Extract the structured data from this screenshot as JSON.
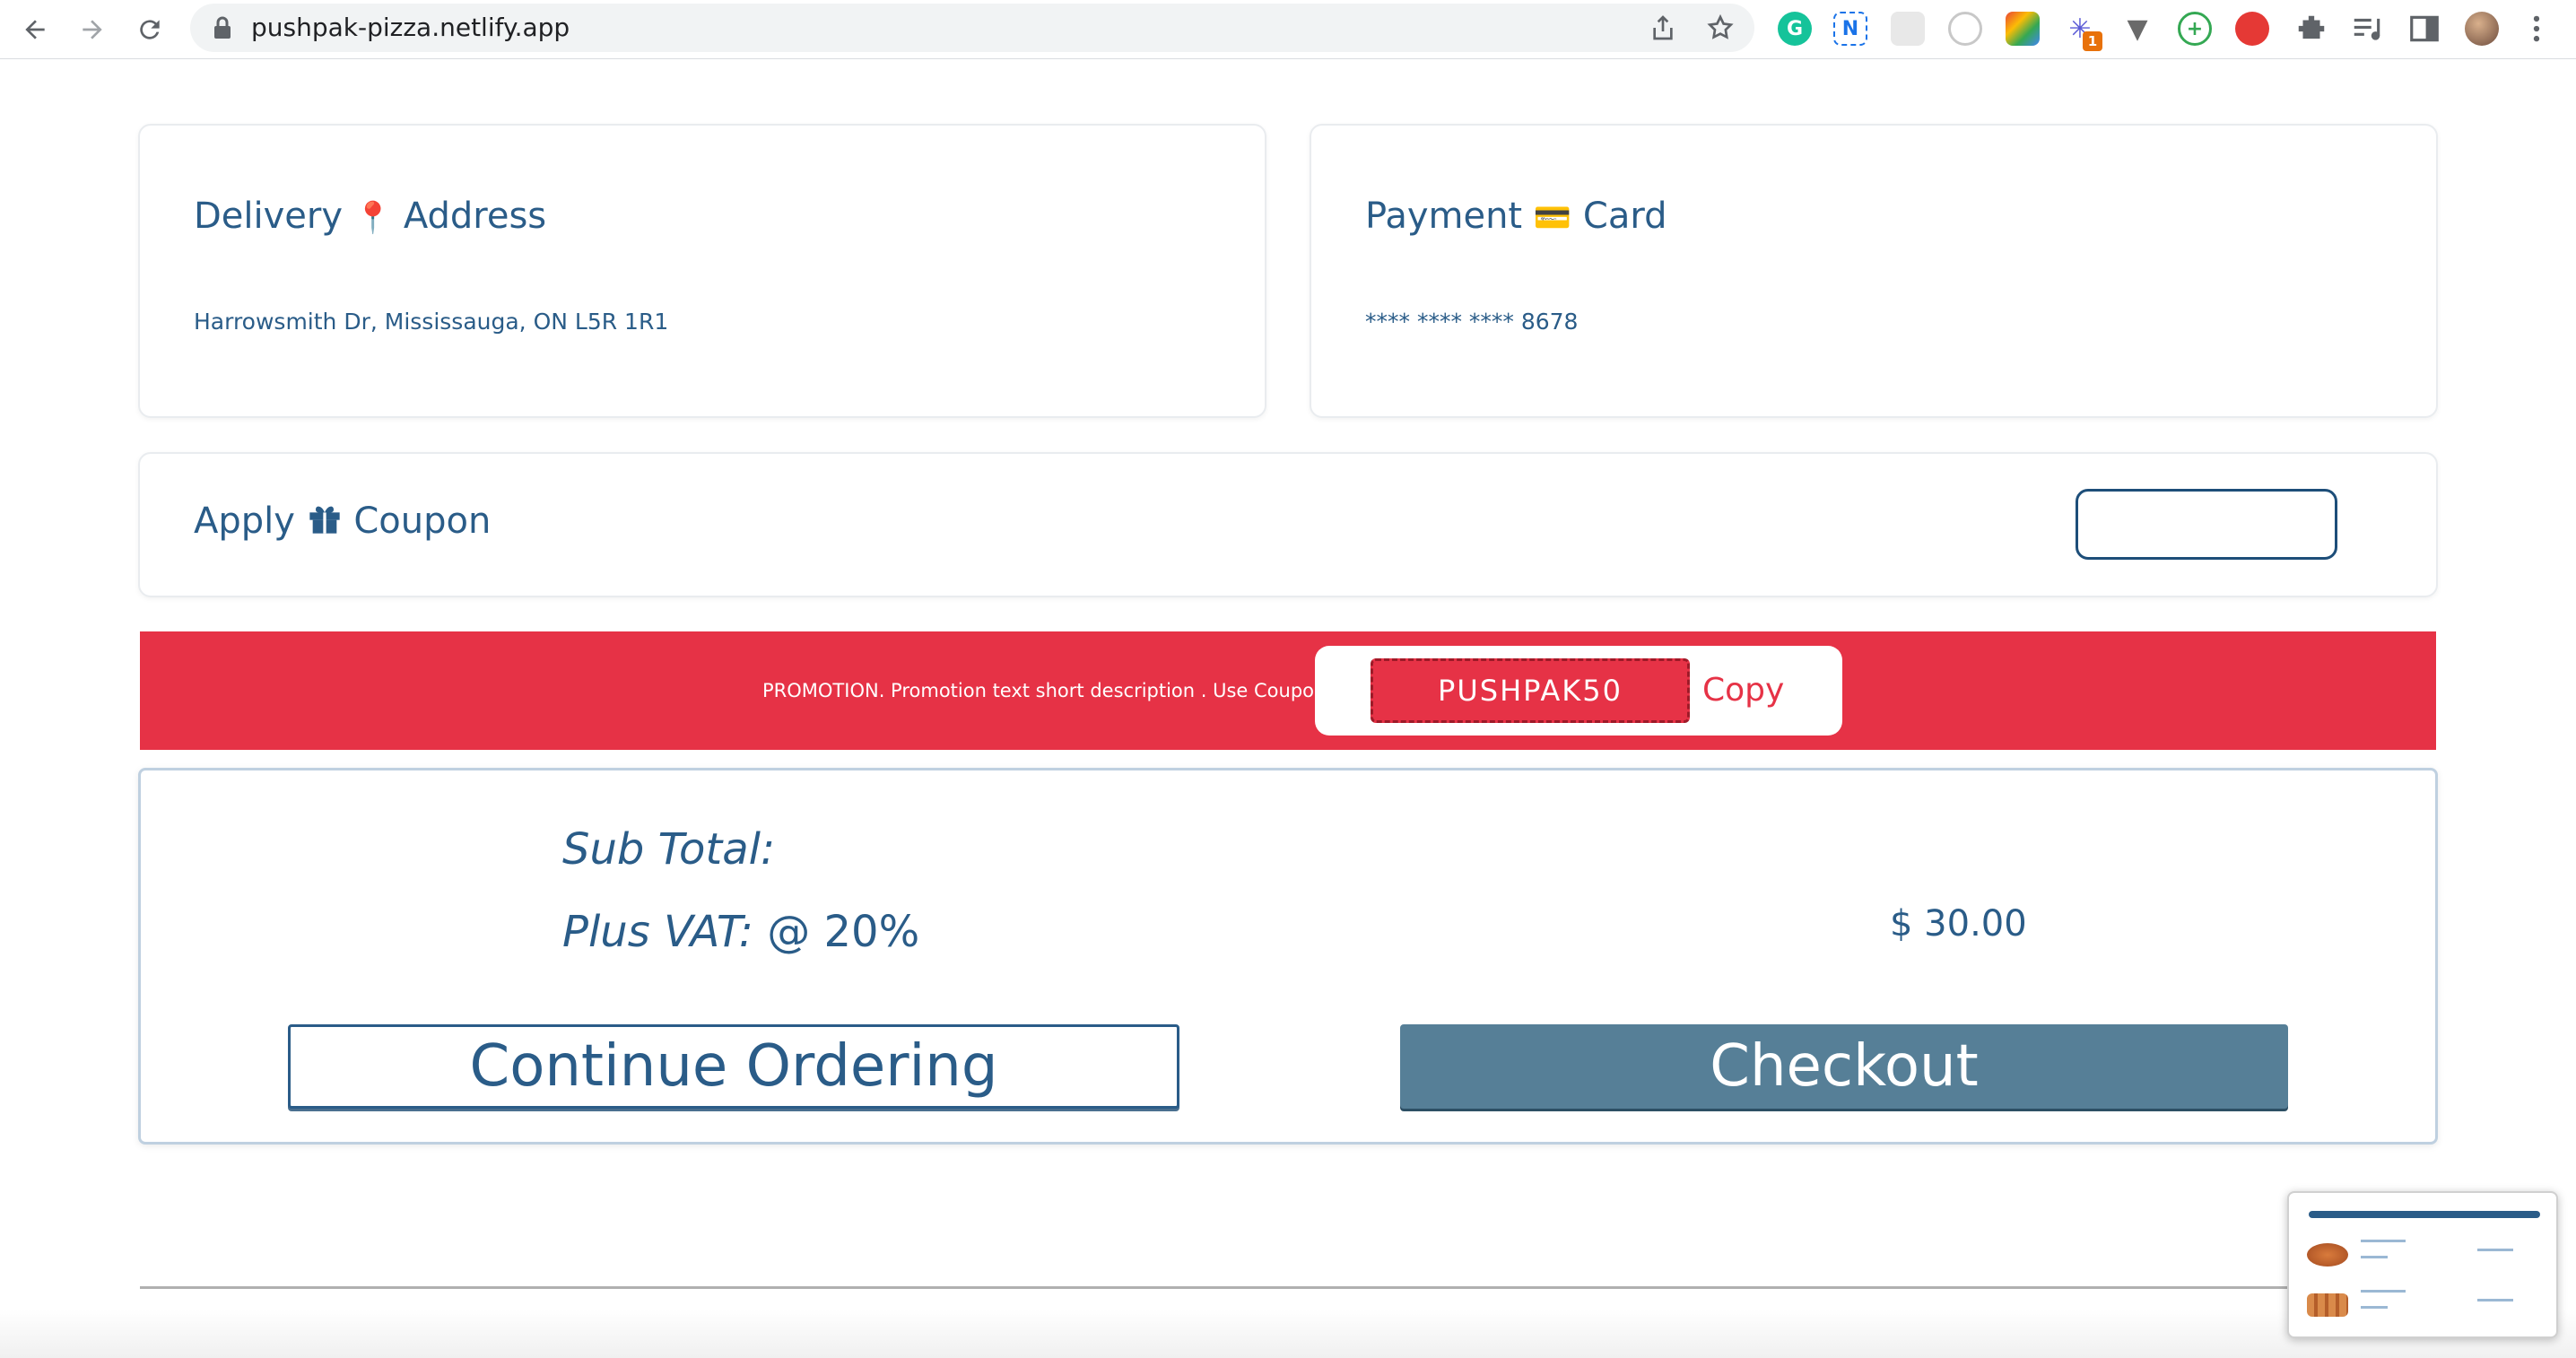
{
  "browser": {
    "url": "pushpak-pizza.netlify.app",
    "extension_badge": "1"
  },
  "delivery": {
    "title_pre": "Delivery",
    "title_icon": "📍",
    "title_post": "Address",
    "address": "Harrowsmith Dr, Mississauga, ON L5R 1R1"
  },
  "payment": {
    "title_pre": "Payment",
    "title_icon": "💳",
    "title_post": "Card",
    "card": "**** **** **** 8678"
  },
  "coupon": {
    "title_pre": "Apply",
    "title_post": "Coupon",
    "input_value": ""
  },
  "promo": {
    "text": "PROMOTION. Promotion text short description . Use Coupon",
    "code": "PUSHPAK50",
    "copy_label": "Copy"
  },
  "totals": {
    "subtotal_label": "Sub Total:",
    "vat_label": "Plus VAT:",
    "vat_rate": "@ 20%",
    "amount": "$ 30.00"
  },
  "actions": {
    "continue_label": "Continue Ordering",
    "checkout_label": "Checkout"
  },
  "colors": {
    "brand_blue": "#2a5c88",
    "promo_red": "#e63246",
    "checkout_bg": "#567f97"
  }
}
